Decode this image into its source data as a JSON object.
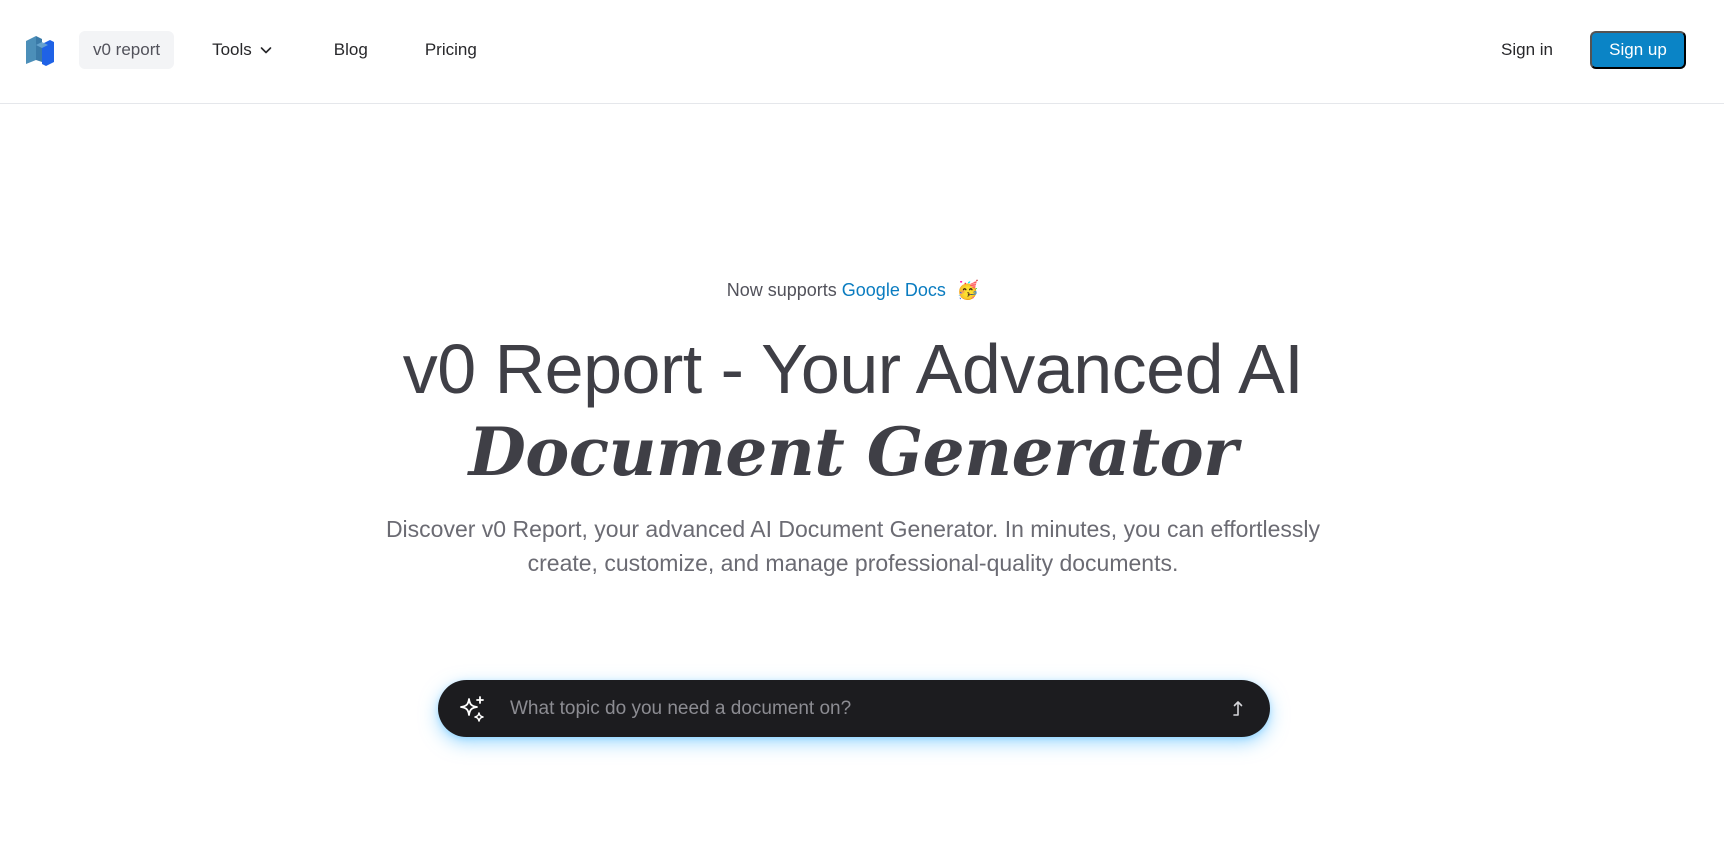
{
  "header": {
    "logo_icon": "stacked-blocks-logo-icon",
    "nav": {
      "home_label": "v0 report",
      "tools_label": "Tools",
      "tools_icon": "chevron-down-icon",
      "blog_label": "Blog",
      "pricing_label": "Pricing"
    },
    "signin_label": "Sign in",
    "signup_label": "Sign up"
  },
  "hero": {
    "supports_prefix": "Now supports",
    "supports_link": "Google Docs",
    "supports_emoji": "🥳",
    "title_line1": "v0 Report - Your Advanced AI",
    "title_line2": "Document Generator",
    "description": "Discover v0 Report, your advanced AI Document Generator. In minutes, you can effortlessly create, customize, and manage professional-quality documents."
  },
  "prompt": {
    "icon": "sparkles-icon",
    "placeholder": "What topic do you need a document on?",
    "value": "",
    "submit_icon": "submit-arrow-icon"
  },
  "colors": {
    "accent": "#0a84c6",
    "link": "#0a7cc0",
    "text": "#3f3f46",
    "prompt_bg": "#1c1c1f",
    "prompt_glow": "#56beff"
  }
}
